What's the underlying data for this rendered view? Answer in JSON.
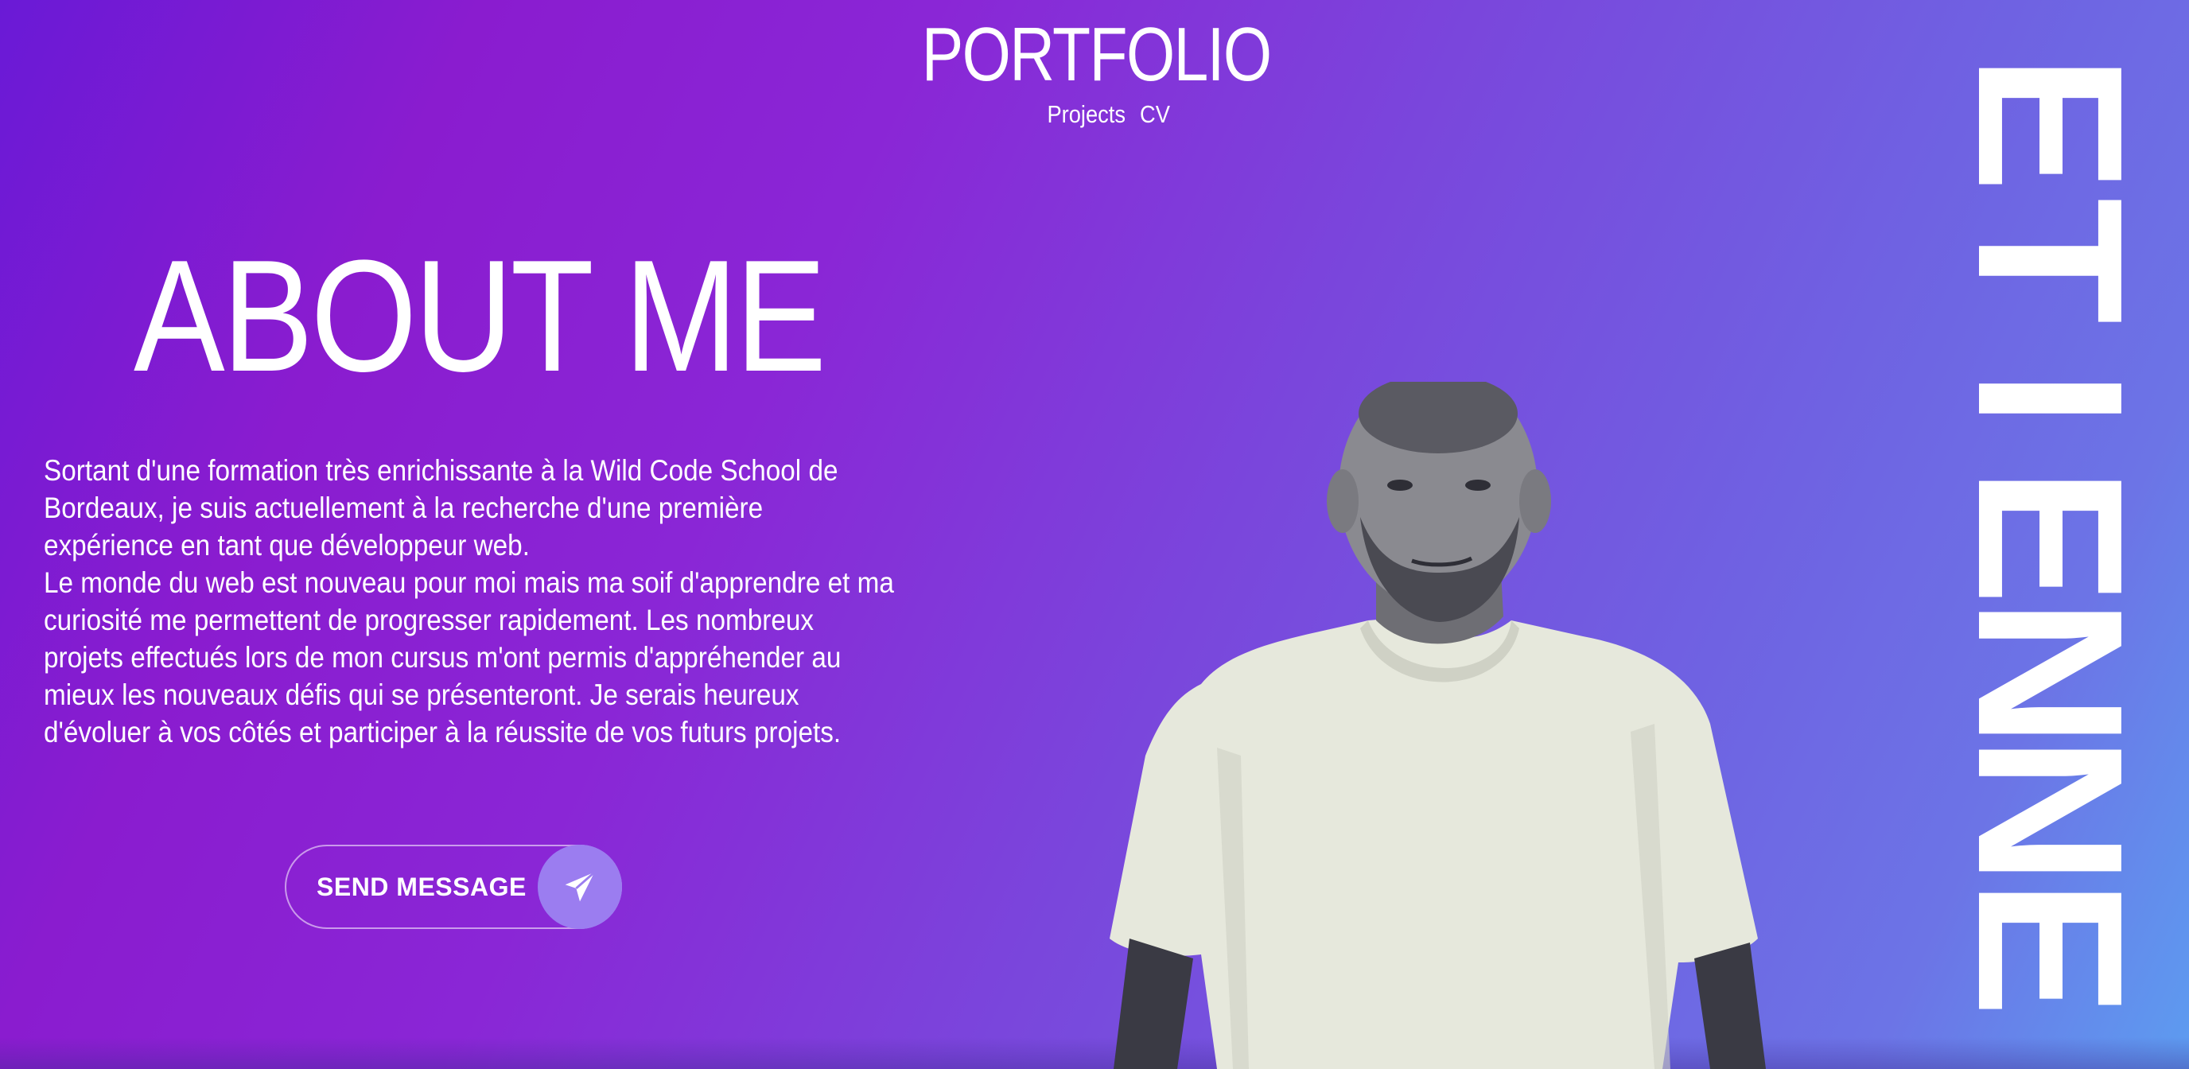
{
  "header": {
    "title": "PORTFOLIO",
    "nav": [
      {
        "label": "Projects"
      },
      {
        "label": "CV"
      }
    ]
  },
  "about": {
    "heading": "ABOUT ME",
    "paragraphs": [
      "Sortant d'une formation très enrichissante à la Wild Code School de Bordeaux, je suis actuellement à la recherche d'une première expérience en tant que développeur web.",
      "Le monde du web est nouveau pour moi mais ma soif d'apprendre et ma curiosité me permettent de progresser rapidement. Les nombreux projets effectués lors de mon cursus m'ont permis d'appréhender au mieux les nouveaux défis qui se présenteront. Je serais heureux d'évoluer à vos côtés et participer à la réussite de vos futurs projets."
    ],
    "send_button_label": "SEND MESSAGE",
    "send_icon": "paper-plane-icon"
  },
  "side_name": {
    "text": "ETIENNE",
    "letters": [
      "E",
      "T",
      "I",
      "E",
      "N",
      "N",
      "E"
    ]
  },
  "colors": {
    "gradient_start": "#6a1ad6",
    "gradient_mid": "#8a26d6",
    "gradient_end": "#5d9cf0",
    "button_icon_bg": "#9b7df0",
    "text": "#ffffff"
  }
}
